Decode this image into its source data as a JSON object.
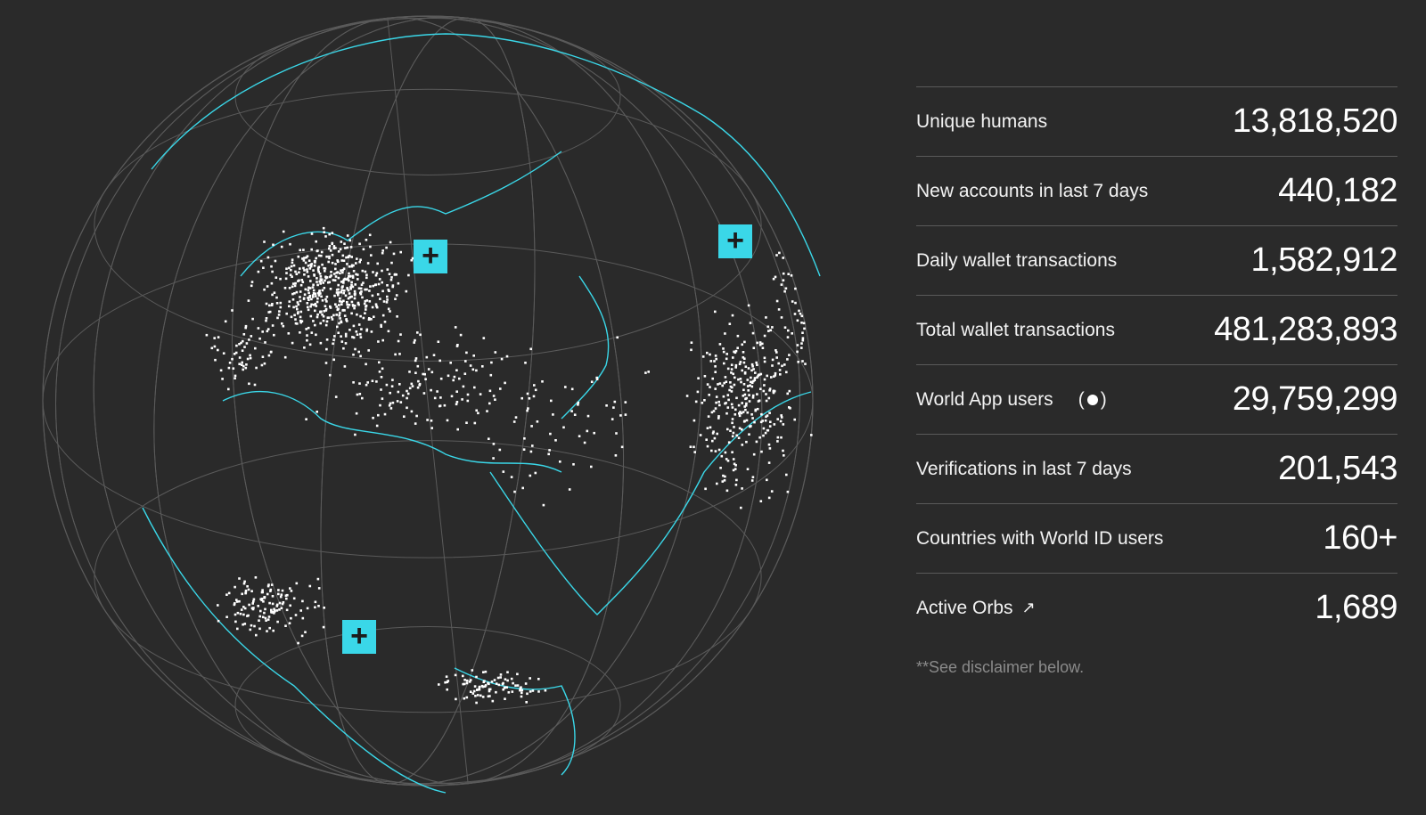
{
  "globe": {
    "colors": {
      "background": "#2a2a2a",
      "grid": "#5a5a5a",
      "coastline": "#3ad7e8",
      "user_dots": "#ffffff",
      "marker": "#3ad7e8"
    },
    "markers": [
      {
        "name": "europe-marker",
        "label": "+"
      },
      {
        "name": "asia-marker",
        "label": "+"
      },
      {
        "name": "africa-marker",
        "label": "+"
      }
    ]
  },
  "stats": [
    {
      "label": "Unique humans",
      "value": "13,818,520"
    },
    {
      "label": "New accounts in last 7 days",
      "value": "440,182"
    },
    {
      "label": "Daily wallet transactions",
      "value": "1,582,912"
    },
    {
      "label": "Total wallet transactions",
      "value": "481,283,893"
    },
    {
      "label": "World App users",
      "value": "29,759,299",
      "icon": "live-indicator-icon"
    },
    {
      "label": "Verifications in last 7 days",
      "value": "201,543"
    },
    {
      "label": "Countries with World ID users",
      "value": "160+"
    },
    {
      "label": "Active Orbs",
      "value": "1,689",
      "icon": "external-arrow-icon"
    }
  ],
  "icons": {
    "live_open": "(",
    "live_close": ")",
    "arrow": "↗"
  },
  "disclaimer": "**See disclaimer below."
}
